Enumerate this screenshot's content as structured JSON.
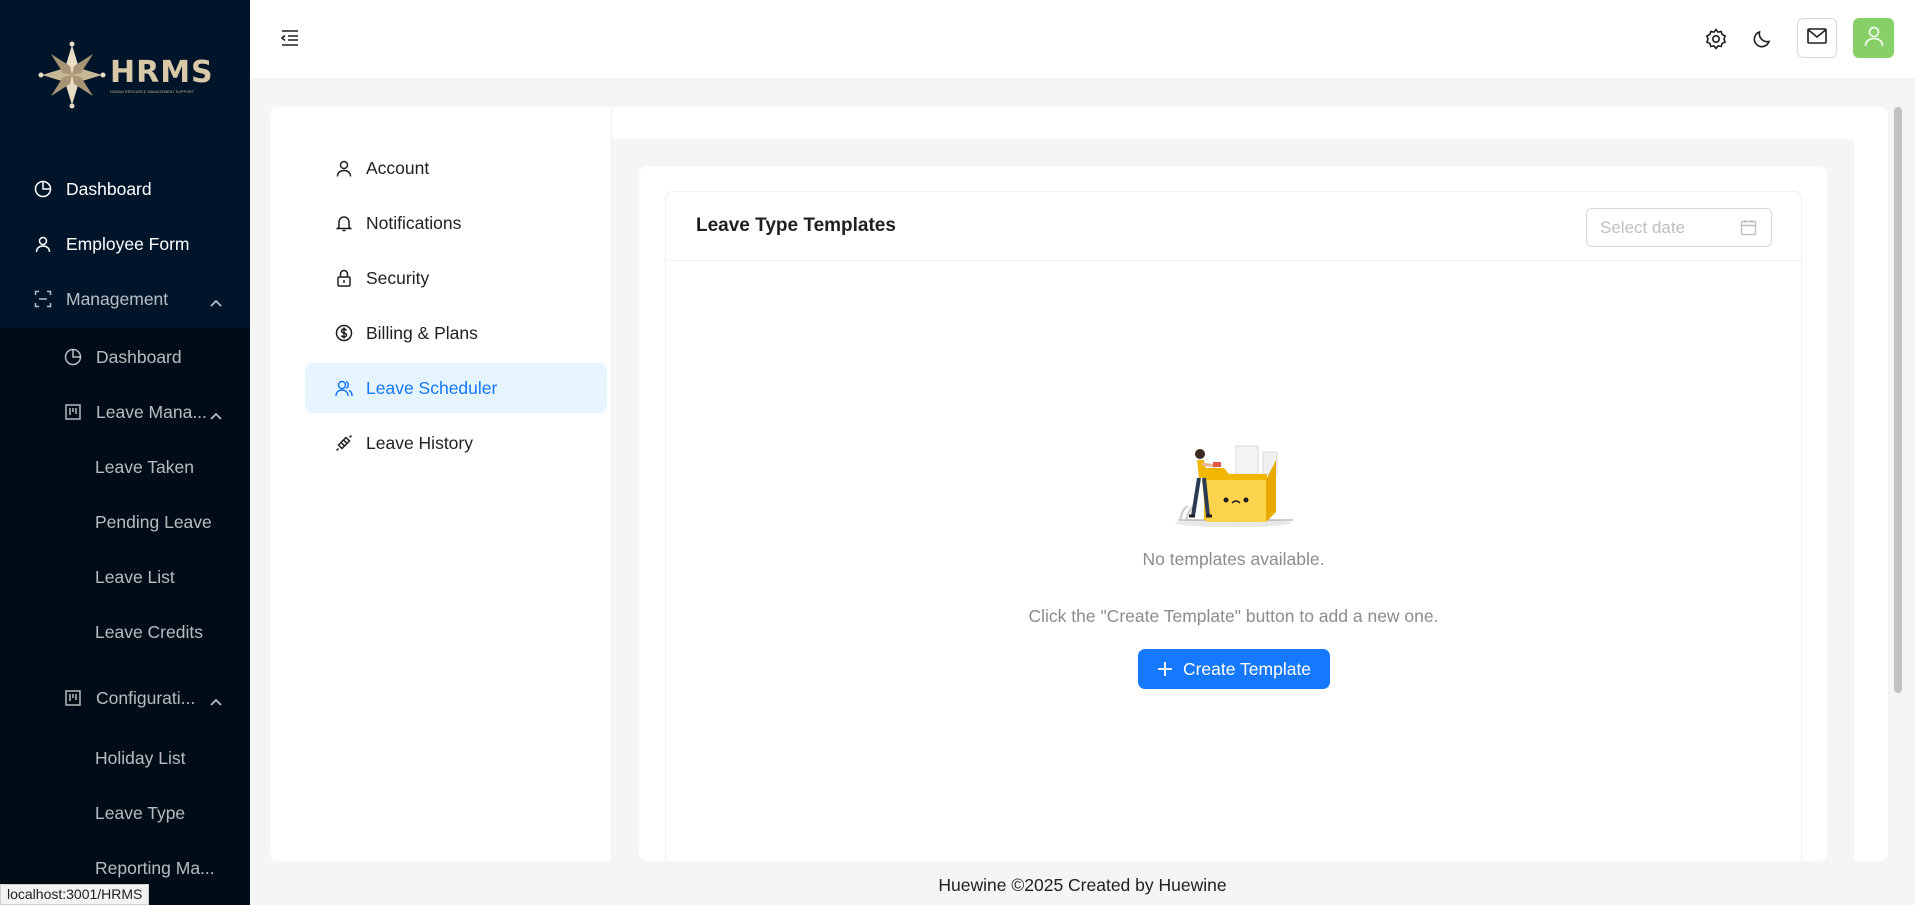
{
  "brand": {
    "logo_word": "HRMS",
    "logo_sub": "HUMAN RESOURCE MANAGEMENT SUPPORT"
  },
  "sidebar": {
    "items": [
      {
        "label": "Dashboard",
        "icon": "pie-chart-icon"
      },
      {
        "label": "Employee Form",
        "icon": "user-icon"
      },
      {
        "label": "Management",
        "icon": "scan-icon"
      }
    ],
    "management_items": [
      {
        "label": "Dashboard",
        "icon": "pie-chart-icon"
      },
      {
        "label": "Leave Mana...",
        "icon": "project-icon"
      },
      {
        "label": "Leave Taken"
      },
      {
        "label": "Pending Leave"
      },
      {
        "label": "Leave List"
      },
      {
        "label": "Leave Credits"
      },
      {
        "label": "Configurati...",
        "icon": "project-icon"
      },
      {
        "label": "Holiday List"
      },
      {
        "label": "Leave Type"
      },
      {
        "label": "Reporting Ma..."
      }
    ]
  },
  "header": {
    "icons": [
      "menu-fold-icon",
      "settings-icon",
      "moon-icon",
      "mail-icon",
      "user-icon"
    ]
  },
  "settings_nav": {
    "items": [
      {
        "label": "Account",
        "icon": "user-icon"
      },
      {
        "label": "Notifications",
        "icon": "bell-icon"
      },
      {
        "label": "Security",
        "icon": "lock-icon"
      },
      {
        "label": "Billing & Plans",
        "icon": "dollar-icon"
      },
      {
        "label": "Leave Scheduler",
        "icon": "team-icon",
        "active": true
      },
      {
        "label": "Leave History",
        "icon": "api-icon"
      }
    ]
  },
  "main": {
    "card_title": "Leave Type Templates",
    "date_placeholder": "Select date",
    "empty_text": "No templates available.",
    "empty_hint": "Click the \"Create Template\" button to add a new one.",
    "create_button": "Create Template"
  },
  "footer": {
    "text": "Huewine ©2025 Created by Huewine"
  },
  "status_bar": {
    "url": "localhost:3001/HRMS"
  },
  "colors": {
    "sidebar_bg": "#001529",
    "submenu_bg": "#000c17",
    "primary": "#1677ff",
    "active_bg": "#e6f4ff",
    "avatar_bg": "#87d068"
  }
}
